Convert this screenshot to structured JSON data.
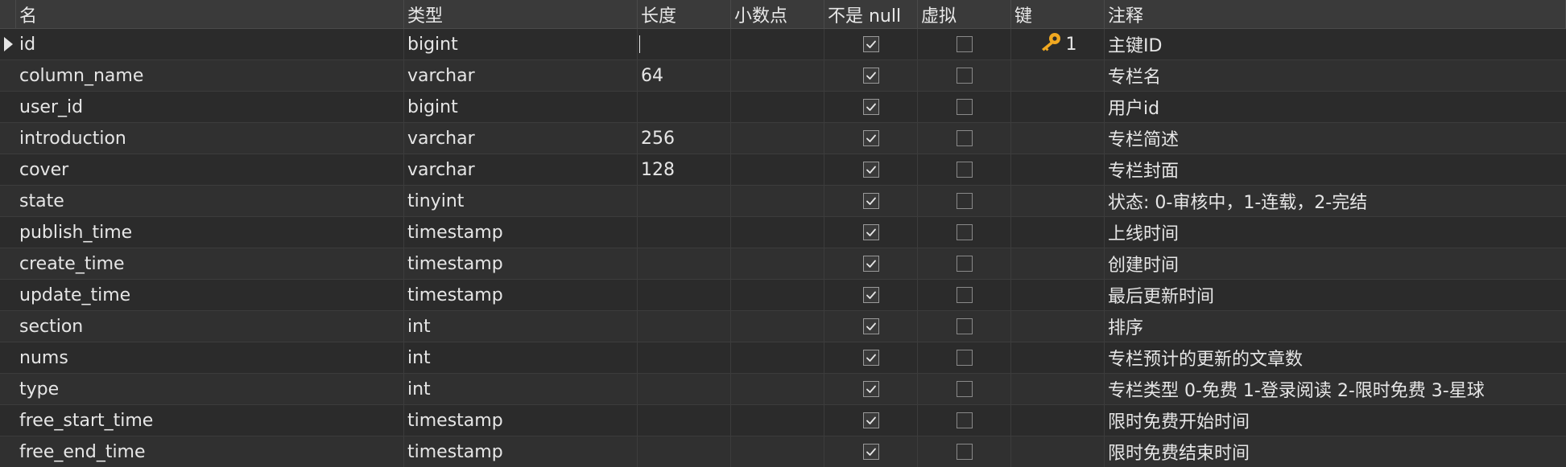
{
  "headers": {
    "name": "名",
    "type": "类型",
    "length": "长度",
    "decimals": "小数点",
    "not_null": "不是 null",
    "virtual": "虚拟",
    "key": "键",
    "comment": "注释"
  },
  "rows": [
    {
      "name": "id",
      "type": "bigint",
      "length": "",
      "decimals": "",
      "not_null": true,
      "virtual": false,
      "key": "1",
      "comment": "主键ID"
    },
    {
      "name": "column_name",
      "type": "varchar",
      "length": "64",
      "decimals": "",
      "not_null": true,
      "virtual": false,
      "key": "",
      "comment": "专栏名"
    },
    {
      "name": "user_id",
      "type": "bigint",
      "length": "",
      "decimals": "",
      "not_null": true,
      "virtual": false,
      "key": "",
      "comment": "用户id"
    },
    {
      "name": "introduction",
      "type": "varchar",
      "length": "256",
      "decimals": "",
      "not_null": true,
      "virtual": false,
      "key": "",
      "comment": "专栏简述"
    },
    {
      "name": "cover",
      "type": "varchar",
      "length": "128",
      "decimals": "",
      "not_null": true,
      "virtual": false,
      "key": "",
      "comment": "专栏封面"
    },
    {
      "name": "state",
      "type": "tinyint",
      "length": "",
      "decimals": "",
      "not_null": true,
      "virtual": false,
      "key": "",
      "comment": "状态: 0-审核中，1-连载，2-完结"
    },
    {
      "name": "publish_time",
      "type": "timestamp",
      "length": "",
      "decimals": "",
      "not_null": true,
      "virtual": false,
      "key": "",
      "comment": "上线时间"
    },
    {
      "name": "create_time",
      "type": "timestamp",
      "length": "",
      "decimals": "",
      "not_null": true,
      "virtual": false,
      "key": "",
      "comment": "创建时间"
    },
    {
      "name": "update_time",
      "type": "timestamp",
      "length": "",
      "decimals": "",
      "not_null": true,
      "virtual": false,
      "key": "",
      "comment": "最后更新时间"
    },
    {
      "name": "section",
      "type": "int",
      "length": "",
      "decimals": "",
      "not_null": true,
      "virtual": false,
      "key": "",
      "comment": "排序"
    },
    {
      "name": "nums",
      "type": "int",
      "length": "",
      "decimals": "",
      "not_null": true,
      "virtual": false,
      "key": "",
      "comment": "专栏预计的更新的文章数"
    },
    {
      "name": "type",
      "type": "int",
      "length": "",
      "decimals": "",
      "not_null": true,
      "virtual": false,
      "key": "",
      "comment": "专栏类型 0-免费 1-登录阅读 2-限时免费 3-星球"
    },
    {
      "name": "free_start_time",
      "type": "timestamp",
      "length": "",
      "decimals": "",
      "not_null": true,
      "virtual": false,
      "key": "",
      "comment": "限时免费开始时间"
    },
    {
      "name": "free_end_time",
      "type": "timestamp",
      "length": "",
      "decimals": "",
      "not_null": true,
      "virtual": false,
      "key": "",
      "comment": "限时免费结束时间"
    }
  ],
  "icons": {
    "key": "key-icon",
    "checkbox_checked": "checkbox-checked-icon",
    "checkbox_unchecked": "checkbox-unchecked-icon",
    "row_indicator": "row-indicator-icon"
  },
  "colors": {
    "background": "#2b2b2b",
    "header_background": "#3a3a3a",
    "text": "#e6e6e6",
    "key_gold": "#f0a820"
  }
}
